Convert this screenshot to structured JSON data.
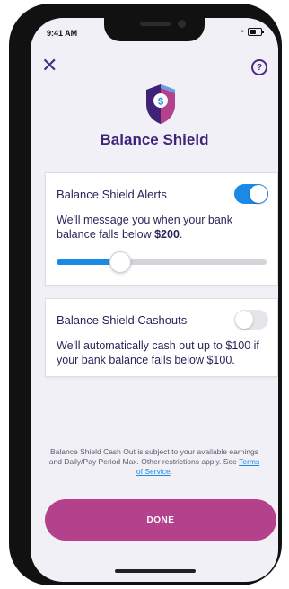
{
  "status_bar": {
    "time": "9:41 AM"
  },
  "header": {
    "help_icon_text": "?"
  },
  "title": "Balance Shield",
  "alerts_card": {
    "title": "Balance Shield Alerts",
    "text_before": "We'll message you when your bank balance falls below ",
    "amount": "$200",
    "text_after": ".",
    "toggle_on": true,
    "slider_value_fraction": 0.3
  },
  "cashouts_card": {
    "title": "Balance Shield Cashouts",
    "text": "We'll automatically cash out up to $100 if your bank balance falls below $100.",
    "toggle_on": false
  },
  "disclaimer": {
    "text": "Balance Shield Cash Out is subject to your available earnings and Daily/Pay Period Max. Other restrictions apply. See ",
    "link": "Terms of Service",
    "suffix": "."
  },
  "done_button": "DONE",
  "colors": {
    "primary": "#3f2377",
    "accent": "#b4418b",
    "toggle_blue": "#1b8ae6"
  },
  "icons": {
    "close": "close-icon",
    "help": "help-icon",
    "logo": "shield-dollar-icon"
  }
}
